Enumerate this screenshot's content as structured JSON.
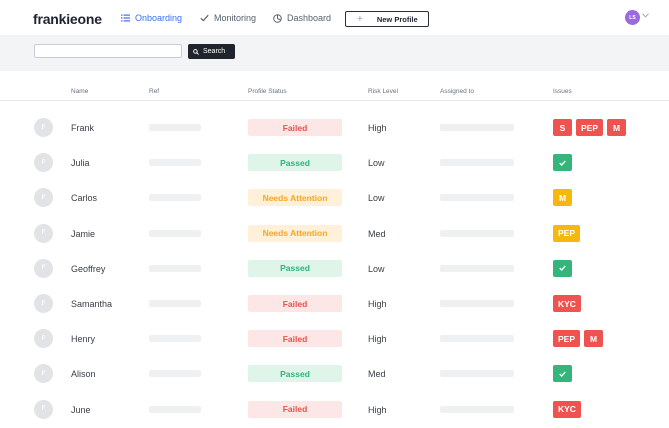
{
  "app": {
    "logo": "frankieone"
  },
  "nav": [
    {
      "label": "Onboarding",
      "icon": "list-icon",
      "active": true
    },
    {
      "label": "Monitoring",
      "icon": "check-icon",
      "active": false
    },
    {
      "label": "Dashboard",
      "icon": "dashboard-icon",
      "active": false
    }
  ],
  "actions": {
    "new_profile": "New Profile",
    "new_profile_icon": "+"
  },
  "user": {
    "initials": "LS"
  },
  "search": {
    "button_label": "Search",
    "value": "",
    "placeholder": ""
  },
  "table": {
    "headers": [
      "Name",
      "Ref",
      "Profile Status",
      "Risk Level",
      "Assigned to",
      "Issues"
    ],
    "rows": [
      {
        "initial": "F",
        "name": "Frank",
        "status": "Failed",
        "risk": "High",
        "issues": [
          "S",
          "PEP",
          "M"
        ]
      },
      {
        "initial": "F",
        "name": "Julia",
        "status": "Passed",
        "risk": "Low",
        "issues": [
          "✓"
        ]
      },
      {
        "initial": "F",
        "name": "Carlos",
        "status": "Needs Attention",
        "risk": "Low",
        "issues": [
          "M"
        ]
      },
      {
        "initial": "F",
        "name": "Jamie",
        "status": "Needs Attention",
        "risk": "Med",
        "issues": [
          "PEP"
        ]
      },
      {
        "initial": "F",
        "name": "Geoffrey",
        "status": "Passed",
        "risk": "Low",
        "issues": [
          "✓"
        ]
      },
      {
        "initial": "F",
        "name": "Samantha",
        "status": "Failed",
        "risk": "High",
        "issues": [
          "KYC"
        ]
      },
      {
        "initial": "F",
        "name": "Henry",
        "status": "Failed",
        "risk": "High",
        "issues": [
          "PEP",
          "M"
        ]
      },
      {
        "initial": "F",
        "name": "Alison",
        "status": "Passed",
        "risk": "Med",
        "issues": [
          "✓"
        ]
      },
      {
        "initial": "F",
        "name": "June",
        "status": "Failed",
        "risk": "High",
        "issues": [
          "KYC"
        ]
      }
    ]
  },
  "colors": {
    "accent": "#3b6ff0",
    "failed_bg": "#fde7e6",
    "failed_fg": "#e5534b",
    "passed_bg": "#dff5ea",
    "passed_fg": "#2fb47a",
    "attention_bg": "#fff1d9",
    "attention_fg": "#f5a623",
    "badge_red": "#ef5350",
    "badge_yellow": "#f6b80f",
    "badge_green": "#35b57a"
  }
}
